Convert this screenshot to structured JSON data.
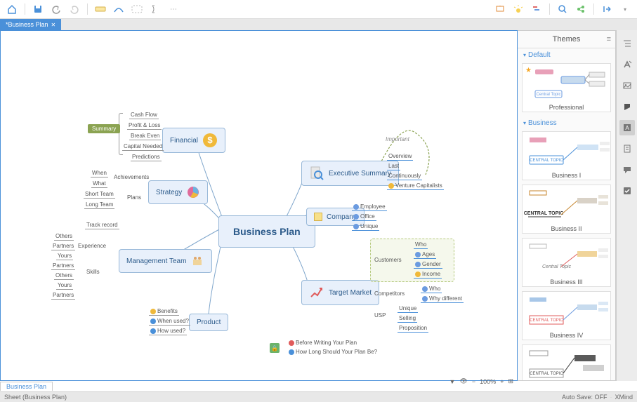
{
  "tab": "*Business Plan",
  "sheet_tab": "Business Plan",
  "footer_sheet": "Sheet (Business Plan)",
  "footer_autosave": "Auto Save: OFF",
  "footer_brand": "XMind",
  "zoom": "100%",
  "themes_panel": {
    "title": "Themes",
    "sections": {
      "default": "Default",
      "business": "Business"
    },
    "cards": {
      "professional": "Professional",
      "business1": "Business I",
      "business2": "Business II",
      "business3": "Business III",
      "business4": "Business IV",
      "central": "Central Topic",
      "centralCaps": "CENTRAL TOPIC"
    }
  },
  "mindmap": {
    "central": "Business Plan",
    "financial": {
      "label": "Financial",
      "leaves": [
        "Cash Flow",
        "Profit & Loss",
        "Break Even",
        "Capital Needed",
        "Predictions"
      ]
    },
    "strategy": {
      "label": "Strategy",
      "plans": "Plans",
      "ach": "Achievements",
      "leaves": [
        "When",
        "What",
        "Short Team",
        "Long Team"
      ]
    },
    "mgmt": {
      "label": "Management Team",
      "exp": "Experience",
      "skills": "Skills",
      "tr": "Track record",
      "groups": [
        "Others",
        "Partners",
        "Yours",
        "Partners",
        "Others",
        "Yours",
        "Partners"
      ]
    },
    "product": {
      "label": "Product",
      "leaves": [
        "Benefits",
        "When used?",
        "How used?"
      ]
    },
    "exec": {
      "label": "Executive Summary",
      "leaves": [
        "Overview",
        "Last",
        "Continuously",
        "Venture Capitalists"
      ],
      "important": "Important"
    },
    "company": {
      "label": "Company",
      "leaves": [
        "Employee",
        "Office",
        "Unique"
      ]
    },
    "target": {
      "label": "Target Market",
      "cust": "Customers",
      "comp": "Competitors",
      "usp": "USP",
      "custLeaves": [
        "Who",
        "Ages",
        "Gender",
        "Income"
      ],
      "compLeaves": [
        "Who",
        "Why different"
      ],
      "uspLeaves": [
        "Unique",
        "Selling",
        "Proposition"
      ]
    },
    "floating": [
      "Before Writing Your Plan",
      "How Long Should Your Plan Be?"
    ],
    "summary": "Summary"
  }
}
